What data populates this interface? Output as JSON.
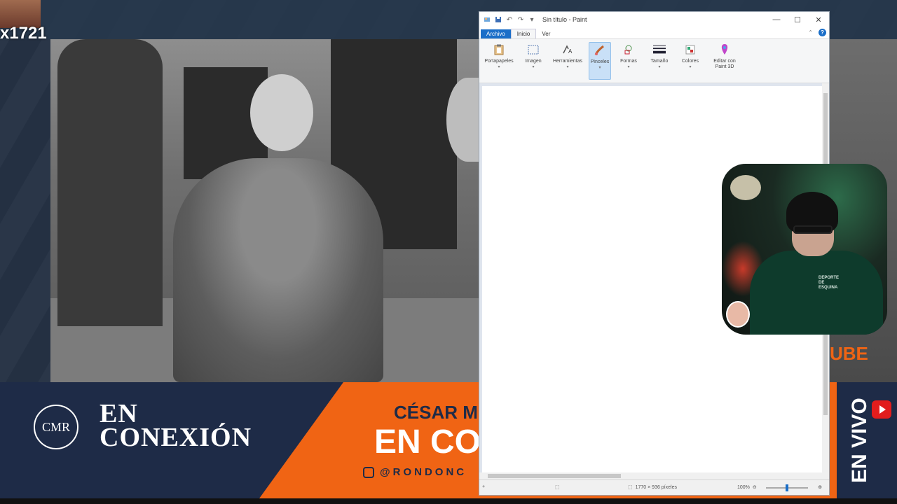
{
  "overlay": {
    "top_left_label": "x1721",
    "cmr_logo": "CMR",
    "show_title_line1": "EN",
    "show_title_line2": "CONEXIÓN",
    "host_name_partial": "CÉSAR M",
    "big_text_partial": "EN CO",
    "instagram_handle_partial": "@RONDONC",
    "side_text_partial": "UBE",
    "live_label": "EN VIVO",
    "colors": {
      "navy": "#1e2b47",
      "orange": "#f06414",
      "youtube_red": "#e21d1d"
    }
  },
  "paint": {
    "title": "Sin título - Paint",
    "quick_access": {
      "save_icon": "save-icon",
      "undo_icon": "undo-icon",
      "redo_icon": "redo-icon",
      "customize": "▾"
    },
    "window_buttons": {
      "minimize": "—",
      "maximize": "☐",
      "close": "✕"
    },
    "tabs": {
      "file": "Archivo",
      "home": "Inicio",
      "view": "Ver"
    },
    "help": "?",
    "ribbon": {
      "clipboard": "Portapapeles",
      "image": "Imagen",
      "tools": "Herramientas",
      "brushes": "Pinceles",
      "shapes": "Formas",
      "size": "Tamaño",
      "colors": "Colores",
      "edit3d": "Editar con Paint 3D",
      "dropdown_mark": "▾"
    },
    "status": {
      "image_size": "1770 × 936 píxeles",
      "zoom": "100%",
      "zoom_level_fraction": 0.5
    }
  },
  "webcam": {
    "hoodie_text": "DEPORTE DE ESQUINA"
  }
}
